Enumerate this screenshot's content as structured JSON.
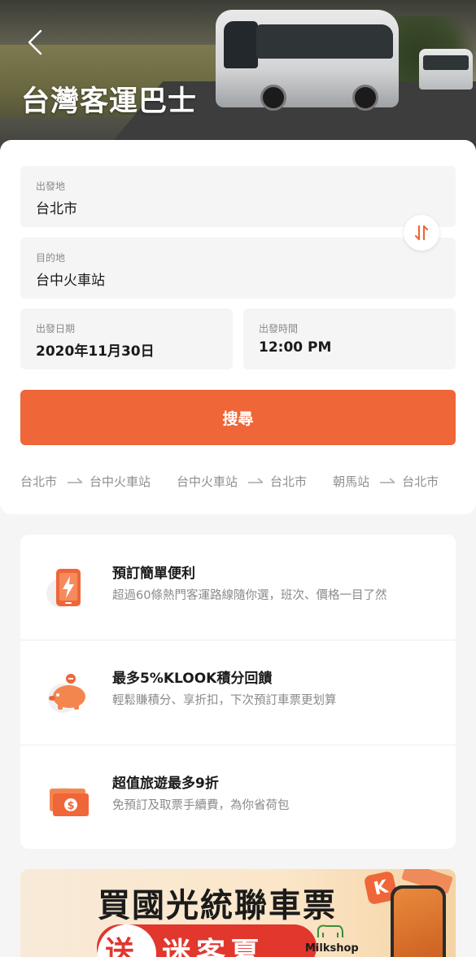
{
  "header": {
    "title": "台灣客運巴士"
  },
  "search": {
    "origin_label": "出發地",
    "origin_value": "台北市",
    "destination_label": "目的地",
    "destination_value": "台中火車站",
    "date_label": "出發日期",
    "date_value": "2020年11月30日",
    "time_label": "出發時間",
    "time_value": "12:00 PM",
    "search_button": "搜尋"
  },
  "recent_routes": [
    {
      "from": "台北市",
      "to": "台中火車站"
    },
    {
      "from": "台中火車站",
      "to": "台北市"
    },
    {
      "from": "朝馬站",
      "to": "台北市"
    }
  ],
  "benefits": [
    {
      "title": "預訂簡單便利",
      "description": "超過60條熱門客運路線隨你選，班次、價格一目了然",
      "icon": "phone-lightning-icon"
    },
    {
      "title": "最多5%KLOOK積分回饋",
      "description": "輕鬆賺積分、享折扣，下次預訂車票更划算",
      "icon": "piggy-bank-icon"
    },
    {
      "title": "超值旅遊最多9折",
      "description": "免預訂及取票手續費，為你省荷包",
      "icon": "money-icon"
    }
  ],
  "promo": {
    "title": "買國光統聯車票",
    "give": "送",
    "highlight": "迷客夏",
    "brand": "Milkshop",
    "badge": "K"
  },
  "colors": {
    "accent": "#ef6638",
    "card_background": "#ffffff",
    "page_background": "#f5f5f5",
    "field_background": "#f5f5f5"
  }
}
